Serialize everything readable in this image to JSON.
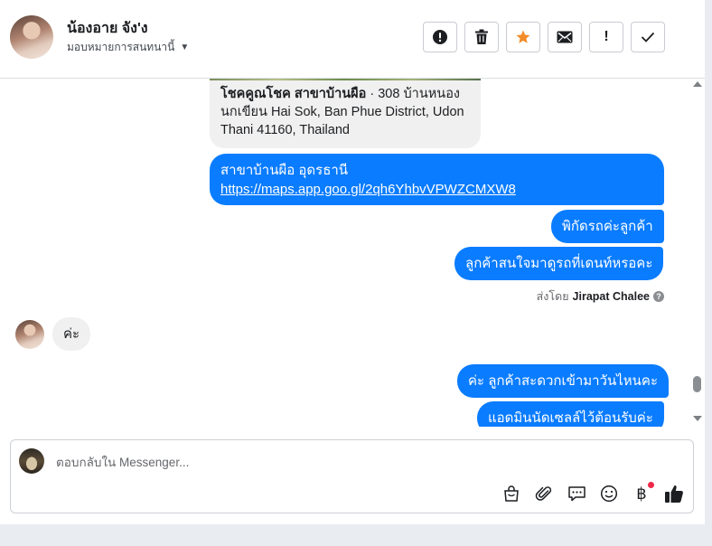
{
  "header": {
    "contact_name": "น้องอาย จัง'ง",
    "assign_label": "มอบหมายการสนทนานี้",
    "actions": [
      {
        "name": "report-spam-button",
        "icon": "alert-circle-icon"
      },
      {
        "name": "delete-button",
        "icon": "trash-icon"
      },
      {
        "name": "star-button",
        "icon": "star-icon"
      },
      {
        "name": "mark-unread-button",
        "icon": "envelope-icon"
      },
      {
        "name": "follow-up-button",
        "icon": "exclamation-icon",
        "label": "!"
      },
      {
        "name": "mark-done-button",
        "icon": "check-icon"
      }
    ],
    "accent_star_color": "#f28c28"
  },
  "messages": {
    "location_card": {
      "title_bold": "โชคคูณโชค สาขาบ้านผือ",
      "address": " · 308 บ้านหนองนกเขียน Hai Sok, Ban Phue District, Udon Thani 41160, Thailand"
    },
    "outgoing_1_line1": "สาขาบ้านผือ อุดรธานี",
    "outgoing_1_link": "https://maps.app.goo.gl/2qh6YhbvVPWZCMXW8",
    "outgoing_2": "พิกัดรถค่ะลูกค้า",
    "outgoing_3": "ลูกค้าสนใจมาดูรถที่เดนท์หรอคะ",
    "sent_by_prefix": "ส่งโดย",
    "sent_by_name": "Jirapat Chalee",
    "incoming_1": "ค่ะ",
    "outgoing_4": "ค่ะ ลูกค้าสะดวกเข้ามาวันไหนคะ",
    "outgoing_5": "แอดมินนัดเซลล์ไว้ต้อนรับค่ะ",
    "bubble_color": "#0a7cff"
  },
  "composer": {
    "placeholder": "ตอบกลับใน Messenger...",
    "tools": [
      "shopping-bag-icon",
      "paperclip-icon",
      "chat-bubble-icon",
      "emoji-icon",
      "baht-icon",
      "thumbs-up-icon"
    ],
    "baht_symbol": "฿"
  }
}
